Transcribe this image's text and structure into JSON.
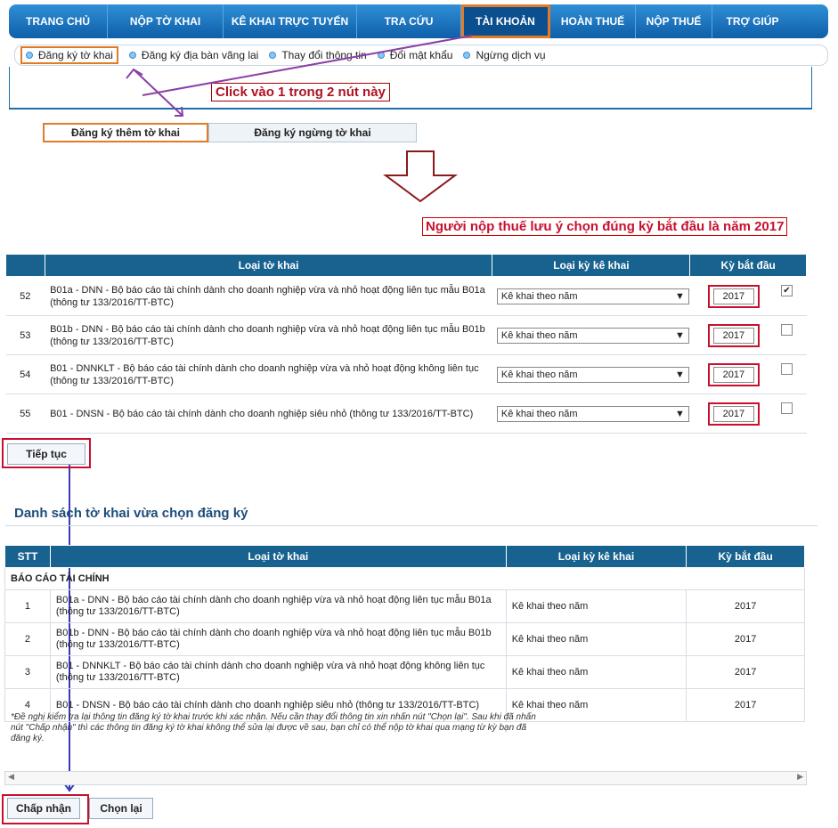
{
  "nav": {
    "items": [
      {
        "label": "TRANG CHỦ",
        "width": 111
      },
      {
        "label": "NỘP TỜ KHAI",
        "width": 130
      },
      {
        "label": "KÊ KHAI TRỰC TUYẾN",
        "width": 150
      },
      {
        "label": "TRA CỨU",
        "width": 117
      },
      {
        "label": "TÀI KHOẢN",
        "width": 100
      },
      {
        "label": "HOÀN THUẾ",
        "width": 96
      },
      {
        "label": "NỘP THUẾ",
        "width": 86
      },
      {
        "label": "TRỢ GIÚP",
        "width": 90
      }
    ]
  },
  "subnav": {
    "items": [
      "Đăng ký tờ khai",
      "Đăng ký địa bàn vãng lai",
      "Thay đổi thông tin",
      "Đổi mật khẩu",
      "Ngừng dịch vụ"
    ]
  },
  "callout": "Click vào 1 trong 2 nút này",
  "tabs": {
    "add": "Đăng ký thêm tờ khai",
    "stop": "Đăng ký ngừng tờ khai"
  },
  "notice": "Người nộp thuế lưu ý chọn đúng kỳ bắt đầu là năm 2017",
  "form_table": {
    "headers": [
      "Loại tờ khai",
      "Loại kỳ kê khai",
      "Kỳ bắt đầu"
    ],
    "rows": [
      {
        "stt": "52",
        "name": "B01a - DNN - Bộ báo cáo tài chính dành cho doanh nghiệp vừa và nhỏ hoạt động liên tục mẫu B01a (thông tư 133/2016/TT-BTC)",
        "period": "Kê khai theo năm",
        "year": "2017",
        "checked": true
      },
      {
        "stt": "53",
        "name": "B01b - DNN - Bộ báo cáo tài chính dành cho doanh nghiệp vừa và nhỏ hoạt động liên tục mẫu B01b (thông tư 133/2016/TT-BTC)",
        "period": "Kê khai theo năm",
        "year": "2017",
        "checked": false
      },
      {
        "stt": "54",
        "name": "B01 - DNNKLT - Bộ báo cáo tài chính dành cho doanh nghiệp vừa và nhỏ hoạt động không liên tục (thông tư 133/2016/TT-BTC)",
        "period": "Kê khai theo năm",
        "year": "2017",
        "checked": false
      },
      {
        "stt": "55",
        "name": "B01 - DNSN - Bộ báo cáo tài chính dành cho doanh nghiệp siêu nhỏ (thông tư 133/2016/TT-BTC)",
        "period": "Kê khai theo năm",
        "year": "2017",
        "checked": false
      }
    ]
  },
  "buttons": {
    "next": "Tiếp tục",
    "accept": "Chấp nhận",
    "reset": "Chọn lại"
  },
  "list": {
    "title": "Danh sách tờ khai vừa chọn đăng ký",
    "headers": [
      "STT",
      "Loại tờ khai",
      "Loại kỳ kê khai",
      "Kỳ bắt đầu"
    ],
    "group": "BÁO CÁO TÀI CHÍNH",
    "rows": [
      {
        "stt": "1",
        "name": "B01a - DNN - Bộ báo cáo tài chính dành cho doanh nghiệp vừa và nhỏ hoạt động liên tục mẫu B01a (thông tư 133/2016/TT-BTC)",
        "period": "Kê khai theo năm",
        "year": "2017"
      },
      {
        "stt": "2",
        "name": "B01b - DNN - Bộ báo cáo tài chính dành cho doanh nghiệp vừa và nhỏ hoạt động liên tục mẫu B01b (thông tư 133/2016/TT-BTC)",
        "period": "Kê khai theo năm",
        "year": "2017"
      },
      {
        "stt": "3",
        "name": "B01 - DNNKLT - Bộ báo cáo tài chính dành cho doanh nghiệp vừa và nhỏ hoạt động không liên tục (thông tư 133/2016/TT-BTC)",
        "period": "Kê khai theo năm",
        "year": "2017"
      },
      {
        "stt": "4",
        "name": "B01 - DNSN - Bộ báo cáo tài chính dành cho doanh nghiệp siêu nhỏ (thông tư 133/2016/TT-BTC)",
        "period": "Kê khai theo năm",
        "year": "2017"
      }
    ],
    "note": "*Đề nghị kiểm tra lại thông tin đăng ký tờ khai trước khi xác nhận. Nếu cần thay đổi thông tin xin nhấn nút \"Chọn lại\". Sau khi đã nhấn nút \"Chấp nhận\" thì các thông tin đăng ký tờ khai không thể sửa lại được về sau, bạn chỉ có thể nộp tờ khai qua mạng từ kỳ bạn đã đăng ký."
  },
  "colors": {
    "nav": "#0e5fa8",
    "highlight": "#e07b28",
    "alert": "#c8102e",
    "annotation": "#8a3fa6",
    "table_header": "#17628f"
  }
}
